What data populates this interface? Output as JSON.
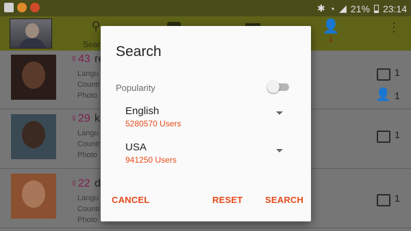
{
  "status_bar": {
    "battery_percent": "21%",
    "time": "23:14",
    "icons": [
      "gallery-icon",
      "app-icon",
      "app-icon",
      "bluetooth-icon",
      "wifi-icon",
      "signal-icon",
      "battery-icon"
    ]
  },
  "app_bar": {
    "search_tab_label": "Search",
    "people_badge_count": "1"
  },
  "list": [
    {
      "age": "43",
      "name": "re",
      "language_label": "Langu",
      "country_label": "Countr",
      "photo_label": "Photo",
      "photo_count": "1",
      "contact_count": "1"
    },
    {
      "age": "29",
      "name": "k",
      "language_label": "Langu",
      "country_label": "Countr",
      "photo_label": "Photo",
      "photo_count": "1"
    },
    {
      "age": "22",
      "name": "d",
      "language_label": "Langu",
      "country_label": "Countr",
      "photo_label": "Photo",
      "photo_count": "1"
    }
  ],
  "dialog": {
    "title": "Search",
    "popularity_label": "Popularity",
    "popularity_enabled": false,
    "language": {
      "value": "English",
      "count": "5280570 Users"
    },
    "country": {
      "value": "USA",
      "count": "941250 Users"
    },
    "buttons": {
      "cancel": "CANCEL",
      "reset": "RESET",
      "search": "SEARCH"
    }
  },
  "colors": {
    "accent": "#e64a19",
    "app_bar": "#5f6318",
    "female_icon": "#7a1f4d"
  }
}
